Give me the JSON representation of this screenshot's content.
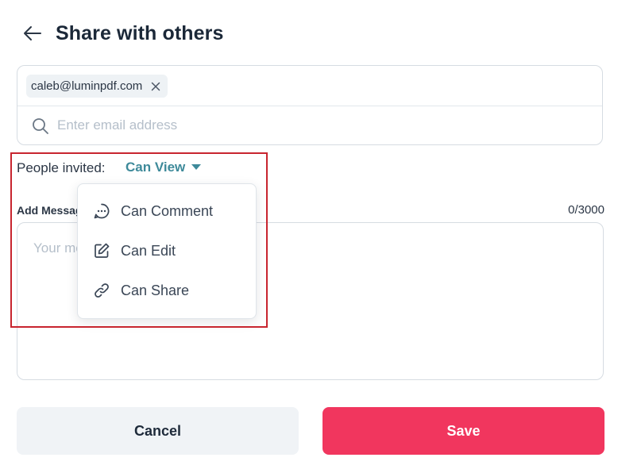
{
  "header": {
    "title": "Share with others"
  },
  "email_box": {
    "chips": [
      {
        "email": "caleb@luminpdf.com"
      }
    ],
    "input_placeholder": "Enter email address",
    "input_value": ""
  },
  "permission": {
    "label": "People invited:",
    "selected": "Can View",
    "options": [
      {
        "label": "Can Comment",
        "icon": "comment-icon"
      },
      {
        "label": "Can Edit",
        "icon": "edit-icon"
      },
      {
        "label": "Can Share",
        "icon": "link-icon"
      }
    ]
  },
  "message": {
    "label": "Add Message",
    "counter": "0/3000",
    "placeholder": "Your message"
  },
  "buttons": {
    "cancel": "Cancel",
    "save": "Save"
  },
  "colors": {
    "accent_teal": "#3e8a9a",
    "save_button": "#f1365e",
    "cancel_button": "#f0f3f6",
    "highlight_border": "#c8252f"
  }
}
